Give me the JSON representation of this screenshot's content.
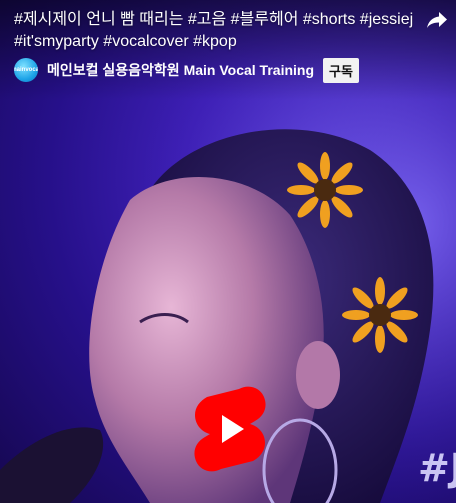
{
  "video": {
    "title": "#제시제이 언니 빰 때리는 #고음 #블루헤어 #shorts #jessiej #it'smyparty #vocalcover #kpop",
    "watermark_text": "#Je"
  },
  "channel": {
    "name": "메인보컬 실용음악학원 Main Vocal Training",
    "avatar_text": "mainvocal",
    "subscribe_label": "구독"
  },
  "icons": {
    "share": "share-icon",
    "play": "youtube-shorts-play-icon"
  },
  "colors": {
    "shorts_red": "#ff0000",
    "background_purple": "#3d1fb5",
    "flower_orange": "#f0a020"
  }
}
